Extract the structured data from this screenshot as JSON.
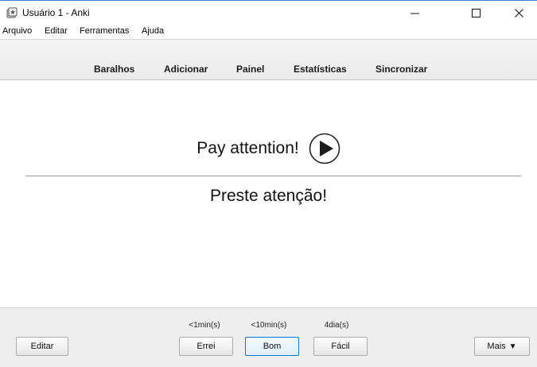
{
  "window": {
    "title": "Usuário 1 - Anki",
    "controls": [
      "minimize-icon",
      "maximize-icon",
      "close-icon"
    ]
  },
  "menu": {
    "items": [
      "Arquivo",
      "Editar",
      "Ferramentas",
      "Ajuda"
    ]
  },
  "toolbar": {
    "links": [
      "Baralhos",
      "Adicionar",
      "Painel",
      "Estatísticas",
      "Sincronizar"
    ]
  },
  "card": {
    "front": "Pay attention!",
    "back": "Preste atenção!",
    "play_icon": "play-icon"
  },
  "bottom": {
    "edit_label": "Editar",
    "more_label": "Mais",
    "more_icon": "caret-down-icon",
    "answers": [
      {
        "interval": "<1min(s)",
        "label": "Errei"
      },
      {
        "interval": "<10min(s)",
        "label": "Bom"
      },
      {
        "interval": "4dia(s)",
        "label": "Fácil"
      }
    ]
  },
  "colors": {
    "focus_border": "#0078d7",
    "toolbar_bg": "#ebebeb",
    "bottom_bg": "#eeeeee"
  }
}
